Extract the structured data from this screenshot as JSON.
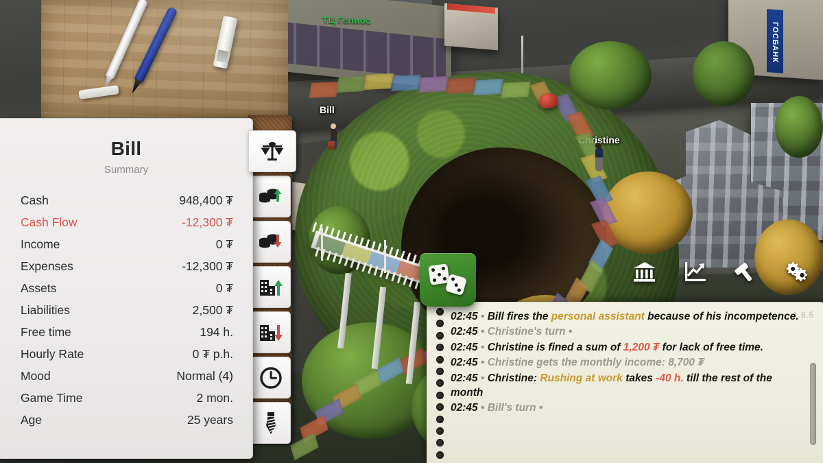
{
  "app": {
    "version": "1.8.5"
  },
  "character_panel": {
    "title": "Bill",
    "subtitle": "Summary",
    "rows": [
      {
        "label": "Cash",
        "value": "948,400 ₮",
        "negative": false
      },
      {
        "label": "Cash Flow",
        "value": "-12,300 ₮",
        "negative": true
      },
      {
        "label": "Income",
        "value": "0 ₮",
        "negative": false
      },
      {
        "label": "Expenses",
        "value": "-12,300 ₮",
        "negative": false
      },
      {
        "label": "Assets",
        "value": "0 ₮",
        "negative": false
      },
      {
        "label": "Liabilities",
        "value": "2,500 ₮",
        "negative": false
      },
      {
        "label": "Free time",
        "value": "194 h.",
        "negative": false
      },
      {
        "label": "Hourly Rate",
        "value": "0 ₮ p.h.",
        "negative": false
      },
      {
        "label": "Mood",
        "value": "Normal (4)",
        "negative": false
      },
      {
        "label": "Game Time",
        "value": "2 mon.",
        "negative": false
      },
      {
        "label": "Age",
        "value": "25 years",
        "negative": false
      }
    ]
  },
  "tabs": [
    {
      "icon": "scales-icon",
      "name": "summary",
      "active": true
    },
    {
      "icon": "coins-up-arrow-icon",
      "name": "income",
      "active": false
    },
    {
      "icon": "coins-down-arrow-icon",
      "name": "expenses",
      "active": false
    },
    {
      "icon": "building-up-arrow-icon",
      "name": "assets",
      "active": false
    },
    {
      "icon": "building-down-arrow-icon",
      "name": "liabilities",
      "active": false
    },
    {
      "icon": "clock-icon",
      "name": "time",
      "active": false
    },
    {
      "icon": "necktie-icon",
      "name": "job",
      "active": false
    }
  ],
  "toolbar": [
    {
      "icon": "bank-icon",
      "name": "bank"
    },
    {
      "icon": "trend-chart-icon",
      "name": "statistics"
    },
    {
      "icon": "hammer-icon",
      "name": "build"
    },
    {
      "icon": "gears-icon",
      "name": "settings"
    }
  ],
  "dice_button": {
    "name": "roll-dice-button",
    "die_one_pips": 5,
    "die_two_pips": 3,
    "color": "#3f8a2b"
  },
  "board": {
    "player_labels": [
      {
        "name": "Bill"
      },
      {
        "name": "Christine"
      }
    ],
    "scene_signs": [
      {
        "text": "ТЦ Гелиос"
      },
      {
        "text": "ГОСБАНК"
      }
    ]
  },
  "log": {
    "entries": [
      {
        "time": "02:45",
        "parts": [
          {
            "text": "Bill fires the ",
            "style": "normal"
          },
          {
            "text": "personal assistant",
            "style": "gold"
          },
          {
            "text": " because of his incompetence.",
            "style": "normal"
          }
        ]
      },
      {
        "time": "02:45",
        "parts": [
          {
            "text": "Christine's turn •",
            "style": "muted"
          }
        ]
      },
      {
        "time": "02:45",
        "parts": [
          {
            "text": "Christine is fined a sum of ",
            "style": "normal"
          },
          {
            "text": "1,200 ₮",
            "style": "red"
          },
          {
            "text": " for lack of free time.",
            "style": "normal"
          }
        ]
      },
      {
        "time": "02:45",
        "parts": [
          {
            "text": "Christine gets the monthly income: 8,700 ₮",
            "style": "muted"
          }
        ]
      },
      {
        "time": "02:45",
        "parts": [
          {
            "text": "Christine: ",
            "style": "normal"
          },
          {
            "text": "Rushing at work",
            "style": "gold"
          },
          {
            "text": " takes ",
            "style": "normal"
          },
          {
            "text": "-40 h.",
            "style": "red"
          },
          {
            "text": " till the rest of the month",
            "style": "normal"
          }
        ]
      },
      {
        "time": "02:45",
        "parts": [
          {
            "text": "Bill's turn •",
            "style": "muted"
          }
        ]
      }
    ]
  },
  "colors": {
    "accent_red": "#d9564e",
    "accent_gold": "#c79a2e",
    "dice_green": "#3f8a2b",
    "panel_bg": "#eceaea",
    "log_bg": "#eceadb"
  }
}
